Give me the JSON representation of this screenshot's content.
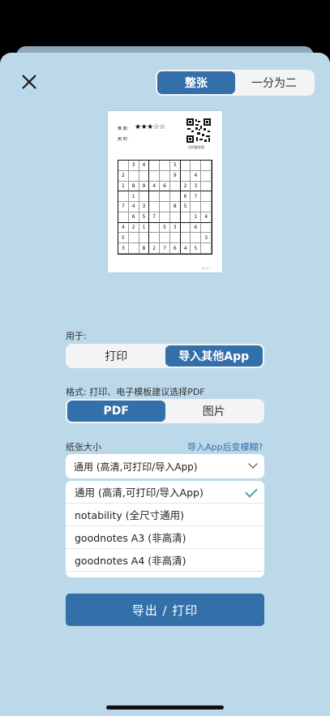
{
  "layout_toggle": {
    "options": [
      "整张",
      "一分为二"
    ],
    "active": 0
  },
  "preview": {
    "difficulty_label": "难 度:",
    "difficulty_stars": "★★★☆☆",
    "time_label": "用 时:",
    "qr_caption": "扫码看答案",
    "footer": "第1页 / 1",
    "grid": [
      [
        "",
        "3",
        "4",
        "",
        "",
        "5",
        "",
        "",
        ""
      ],
      [
        "2",
        "",
        "",
        "",
        "",
        "9",
        "",
        "4",
        ""
      ],
      [
        "1",
        "8",
        "9",
        "4",
        "6",
        "",
        "2",
        "3",
        ""
      ],
      [
        "",
        "1",
        "",
        "",
        "",
        "",
        "6",
        "7",
        ""
      ],
      [
        "7",
        "4",
        "3",
        "",
        "",
        "8",
        "5",
        "",
        ""
      ],
      [
        "",
        "6",
        "5",
        "7",
        "",
        "",
        "",
        "1",
        "4"
      ],
      [
        "4",
        "2",
        "1",
        "",
        "5",
        "3",
        "",
        "6",
        ""
      ],
      [
        "5",
        "",
        "",
        "",
        "",
        "",
        "",
        "",
        "3"
      ],
      [
        "3",
        "",
        "8",
        "2",
        "7",
        "6",
        "4",
        "5",
        ""
      ]
    ]
  },
  "use_section": {
    "label": "用于:",
    "options": [
      "打印",
      "导入其他App"
    ],
    "active": 1
  },
  "format_section": {
    "label": "格式: 打印、电子模板建议选择PDF",
    "options": [
      "PDF",
      "图片"
    ],
    "active": 0
  },
  "paper_section": {
    "label": "纸张大小",
    "help_link": "导入App后变模糊?",
    "selected": "通用 (高清,可打印/导入App)",
    "options": [
      "通用 (高清,可打印/导入App)",
      "notability (全尺寸通用)",
      "goodnotes A3 (非高清)",
      "goodnotes A4 (非高清)"
    ],
    "checked_index": 0
  },
  "export_label": "导出 / 打印",
  "colors": {
    "accent": "#336fa9",
    "sheet_bg": "#bcd9ea",
    "check": "#4aa89a"
  }
}
